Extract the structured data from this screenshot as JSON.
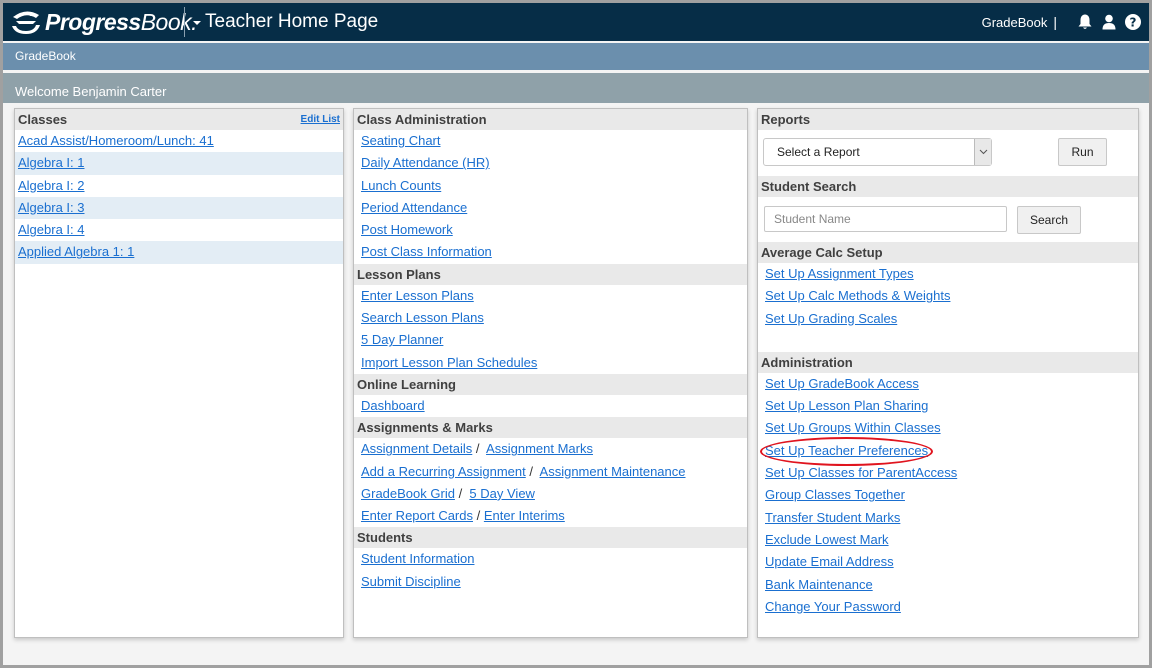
{
  "topbar": {
    "brand_bold": "Progress",
    "brand_light": "Book.",
    "page_title": "Teacher Home Page",
    "app_name": "GradeBook",
    "pipe": "|",
    "icons": [
      "bell-icon",
      "user-icon",
      "help-icon"
    ]
  },
  "subbar": {
    "label": "GradeBook"
  },
  "welcome": {
    "text": "Welcome Benjamin Carter"
  },
  "classes": {
    "title": "Classes",
    "edit_label": "Edit List",
    "items": [
      "Acad Assist/Homeroom/Lunch: 41",
      "Algebra I: 1",
      "Algebra I: 2",
      "Algebra I: 3",
      "Algebra I: 4",
      "Applied Algebra 1: 1"
    ]
  },
  "middle": {
    "class_admin": {
      "title": "Class Administration",
      "links": [
        "Seating Chart",
        "Daily Attendance (HR)",
        "Lunch Counts",
        "Period Attendance",
        "Post Homework",
        "Post Class Information"
      ]
    },
    "lesson_plans": {
      "title": "Lesson Plans",
      "links": [
        "Enter Lesson Plans",
        "Search Lesson Plans",
        "5 Day Planner",
        "Import Lesson Plan Schedules"
      ]
    },
    "online_learning": {
      "title": "Online Learning",
      "links": [
        "Dashboard"
      ]
    },
    "assignments": {
      "title": "Assignments & Marks",
      "rows": [
        [
          "Assignment Details",
          "Assignment Marks"
        ],
        [
          "Add a Recurring Assignment",
          "Assignment Maintenance"
        ],
        [
          "GradeBook Grid",
          "5 Day View"
        ],
        [
          "Enter Report Cards",
          "Enter Interims"
        ]
      ],
      "separator": "/"
    },
    "students": {
      "title": "Students",
      "links": [
        "Student Information",
        "Submit Discipline"
      ]
    }
  },
  "right": {
    "reports": {
      "title": "Reports",
      "select_value": "Select a Report",
      "run_label": "Run"
    },
    "student_search": {
      "title": "Student Search",
      "placeholder": "Student Name",
      "search_label": "Search"
    },
    "avg_calc": {
      "title": "Average Calc Setup",
      "links": [
        "Set Up Assignment Types",
        "Set Up Calc Methods & Weights",
        "Set Up Grading Scales"
      ]
    },
    "administration": {
      "title": "Administration",
      "links": [
        "Set Up GradeBook Access",
        "Set Up Lesson Plan Sharing",
        "Set Up Groups Within Classes",
        "Set Up Teacher Preferences",
        "Set Up Classes for ParentAccess",
        "Group Classes Together",
        "Transfer Student Marks",
        "Exclude Lowest Mark",
        "Update Email Address",
        "Bank Maintenance",
        "Change Your Password"
      ],
      "highlighted": "Set Up Teacher Preferences",
      "highlight_color": "#e0141e"
    }
  },
  "colors": {
    "topbar": "#062d47",
    "subbar": "#6b8fad",
    "welcome_bar": "#8fa1a9",
    "link": "#1a6fd0",
    "row_alt": "#e3edf5",
    "section_header": "#e9e9e9"
  }
}
